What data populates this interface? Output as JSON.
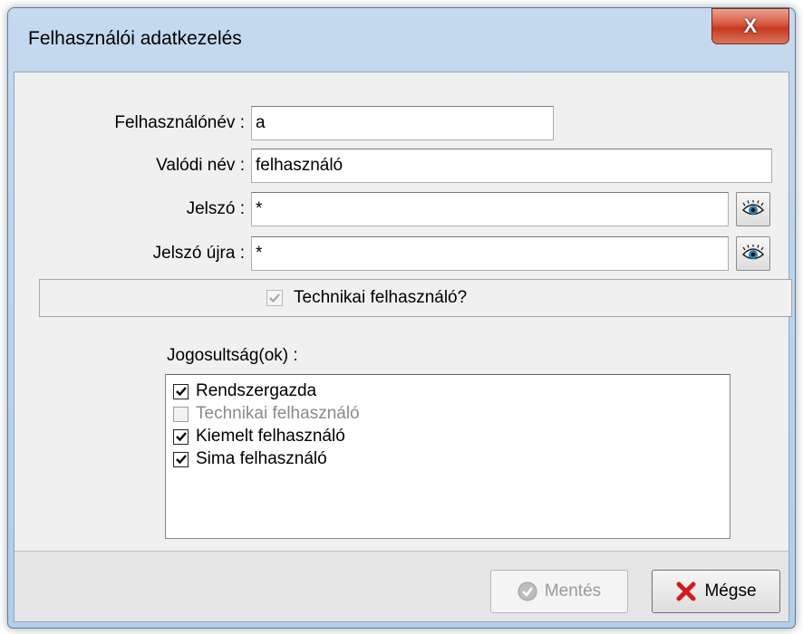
{
  "window": {
    "title": "Felhasználói adatkezelés",
    "close_label": "X"
  },
  "form": {
    "username_label": "Felhasználónév :",
    "username_value": "a",
    "realname_label": "Valódi név :",
    "realname_value": "felhasználó",
    "password_label": "Jelszó :",
    "password_value": "*",
    "password_repeat_label": "Jelszó újra :",
    "password_repeat_value": "*",
    "show_password_icon": "eye-icon"
  },
  "technical_user": {
    "label": "Technikai felhasználó?",
    "checked": true,
    "enabled": false
  },
  "permissions": {
    "label": "Jogosultság(ok) :",
    "items": [
      {
        "label": "Rendszergazda",
        "checked": true,
        "enabled": true
      },
      {
        "label": "Technikai felhasználó",
        "checked": false,
        "enabled": false
      },
      {
        "label": "Kiemelt felhasználó",
        "checked": true,
        "enabled": true
      },
      {
        "label": "Sima felhasználó",
        "checked": true,
        "enabled": true
      }
    ]
  },
  "buttons": {
    "save_label": "Mentés",
    "save_enabled": false,
    "cancel_label": "Mégse"
  },
  "colors": {
    "title_bar": "#b9d1ea",
    "close_button": "#c74a30",
    "cancel_icon": "#d01a1a"
  }
}
